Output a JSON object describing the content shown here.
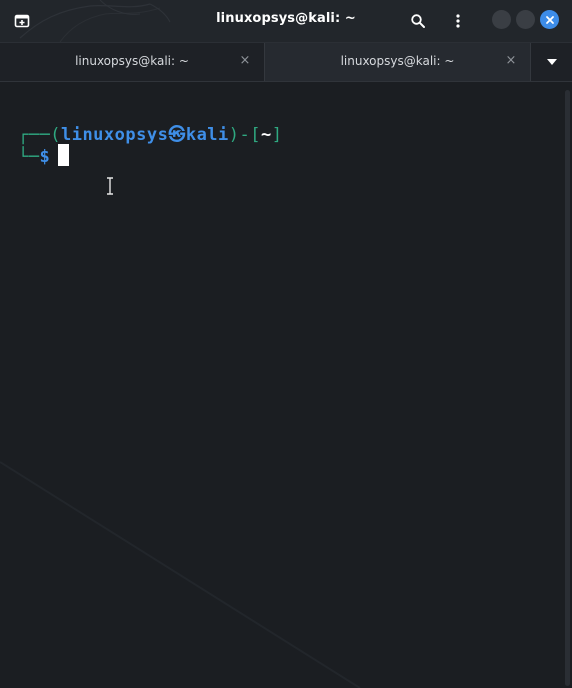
{
  "window": {
    "title": "linuxopsys@kali: ~"
  },
  "header": {
    "new_tab_icon": "new-tab-icon",
    "search_icon": "search-icon",
    "menu_icon": "kebab-menu-icon",
    "colors": {
      "close": "#3d8ce8",
      "minimize": "#3a3e44",
      "maximize": "#3a3e44"
    }
  },
  "tabs": [
    {
      "label": "linuxopsys@kali: ~",
      "close": "×",
      "active": false
    },
    {
      "label": "linuxopsys@kali: ~",
      "close": "×",
      "active": true
    }
  ],
  "tab_menu_icon": "chevron-down-icon",
  "terminal": {
    "prompt": {
      "corner_top": "┌──",
      "open_paren": "(",
      "user": "linuxopsys",
      "at_symbol": "㉿",
      "host": "kali",
      "close_paren": ")",
      "dash": "-",
      "open_bracket": "[",
      "cwd": "~",
      "close_bracket": "]",
      "corner_bottom": "└─",
      "dollar": "$"
    },
    "colors": {
      "green": "#2fa981",
      "blue": "#3f8fe8",
      "background": "#1b1e22"
    }
  }
}
